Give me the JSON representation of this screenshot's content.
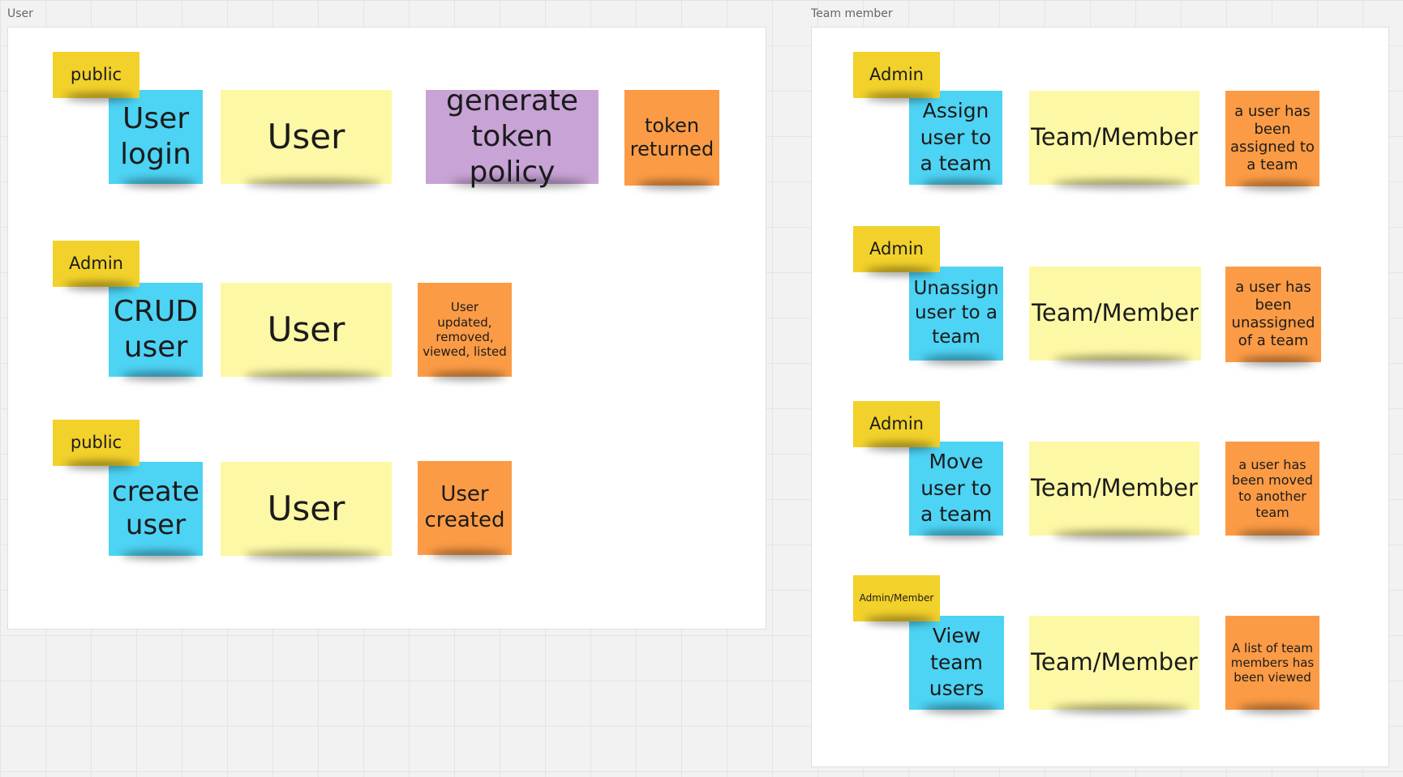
{
  "colors": {
    "actor": "#f2d12b",
    "command": "#4dd3f4",
    "aggregate": "#fdf8a5",
    "policy": "#c8a3d6",
    "event": "#fb9b45"
  },
  "frames": {
    "user": {
      "label": "User",
      "rows": [
        {
          "actor": "public",
          "command": "User login",
          "aggregate": "User",
          "policy": "generate token policy",
          "event": "token returned"
        },
        {
          "actor": "Admin",
          "command": "CRUD user",
          "aggregate": "User",
          "event": "User updated, removed, viewed, listed"
        },
        {
          "actor": "public",
          "command": "create user",
          "aggregate": "User",
          "event": "User created"
        }
      ]
    },
    "team": {
      "label": "Team member",
      "rows": [
        {
          "actor": "Admin",
          "command": "Assign user to a team",
          "aggregate": "Team/Member",
          "event": "a user has been assigned to a team"
        },
        {
          "actor": "Admin",
          "command": "Unassign user to a team",
          "aggregate": "Team/Member",
          "event": "a user has been unassigned of a team"
        },
        {
          "actor": "Admin",
          "command": "Move user to a team",
          "aggregate": "Team/Member",
          "event": "a user has been moved to another team"
        },
        {
          "actor": "Admin/Member",
          "command": "View team users",
          "aggregate": "Team/Member",
          "event": "A list of team members has been viewed"
        }
      ]
    }
  }
}
